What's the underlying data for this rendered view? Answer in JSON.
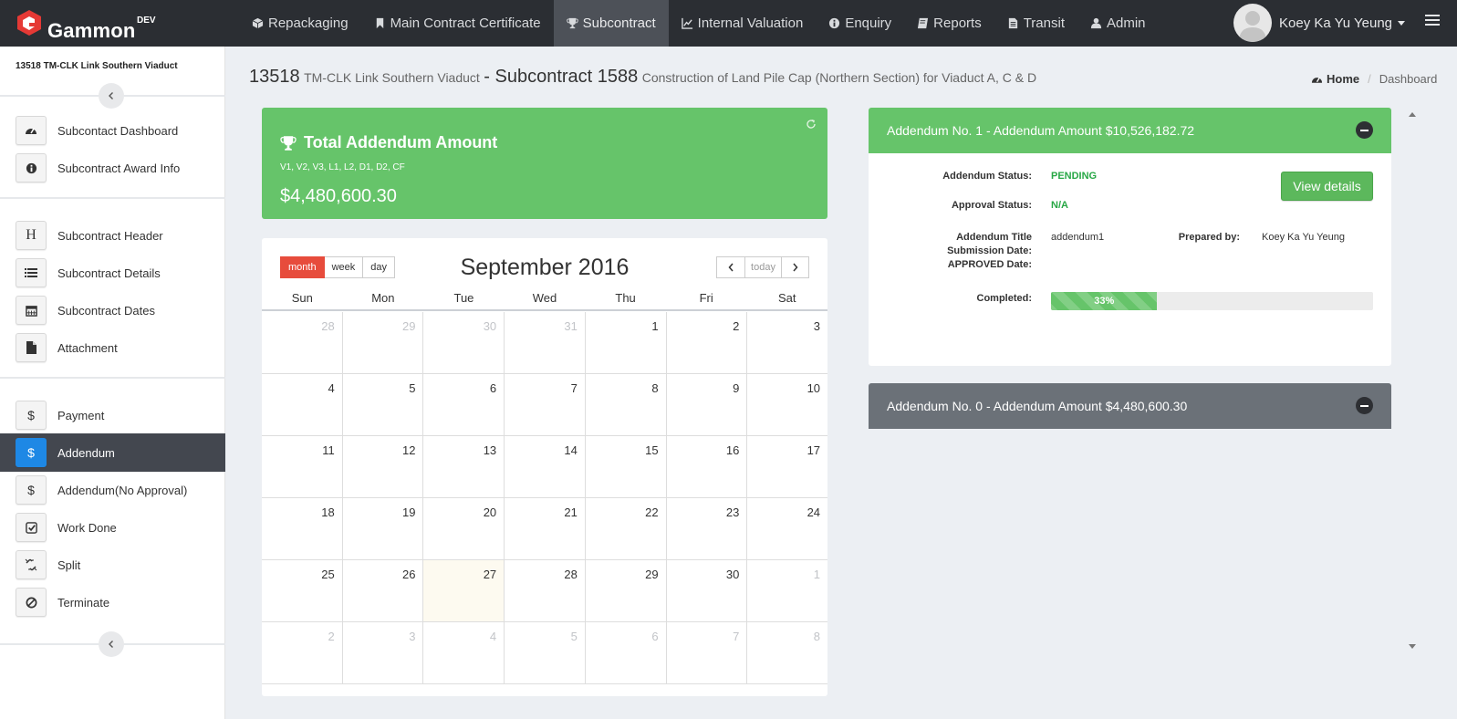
{
  "brand": {
    "name": "Gammon",
    "env": "DEV",
    "accent": "#e53935"
  },
  "nav": [
    {
      "label": "Repackaging",
      "icon": "cube-icon"
    },
    {
      "label": "Main Contract Certificate",
      "icon": "bookmark-icon"
    },
    {
      "label": "Subcontract",
      "icon": "trophy-icon",
      "active": true
    },
    {
      "label": "Internal Valuation",
      "icon": "line-chart-icon"
    },
    {
      "label": "Enquiry",
      "icon": "info-circle-icon"
    },
    {
      "label": "Reports",
      "icon": "book-icon"
    },
    {
      "label": "Transit",
      "icon": "file-icon"
    },
    {
      "label": "Admin",
      "icon": "user-icon"
    }
  ],
  "user": {
    "name": "Koey Ka Yu Yeung"
  },
  "sidebar": {
    "project": "13518 TM-CLK Link Southern Viaduct",
    "items": [
      {
        "label": "Subcontact Dashboard",
        "icon": "dashboard-icon"
      },
      {
        "label": "Subcontract Award Info",
        "icon": "info-circle-icon"
      },
      {
        "label": "Subcontract Header",
        "icon": "header-icon",
        "glyph": "H"
      },
      {
        "label": "Subcontract Details",
        "icon": "list-icon"
      },
      {
        "label": "Subcontract Dates",
        "icon": "calendar-icon"
      },
      {
        "label": "Attachment",
        "icon": "file-icon"
      },
      {
        "label": "Payment",
        "icon": "dollar-icon",
        "glyph": "$"
      },
      {
        "label": "Addendum",
        "icon": "dollar-icon",
        "glyph": "$",
        "active": true
      },
      {
        "label": "Addendum(No Approval)",
        "icon": "dollar-icon",
        "glyph": "$"
      },
      {
        "label": "Work Done",
        "icon": "check-square-icon"
      },
      {
        "label": "Split",
        "icon": "unlink-icon"
      },
      {
        "label": "Terminate",
        "icon": "ban-icon"
      }
    ]
  },
  "header": {
    "job_no": "13518",
    "job_name": "TM-CLK Link Southern Viaduct",
    "subcontract_label": "- Subcontract 1588",
    "subcontract_desc": "Construction of Land Pile Cap (Northern Section) for Viaduct A, C & D"
  },
  "breadcrumb": {
    "home": "Home",
    "current": "Dashboard"
  },
  "total_card": {
    "title": "Total Addendum Amount",
    "codes": "V1, V2, V3, L1, L2, D1, D2, CF",
    "amount": "$4,480,600.30"
  },
  "calendar": {
    "views": [
      "month",
      "week",
      "day"
    ],
    "active_view": "month",
    "title": "September 2016",
    "today_label": "today",
    "weekdays": [
      "Sun",
      "Mon",
      "Tue",
      "Wed",
      "Thu",
      "Fri",
      "Sat"
    ],
    "weeks": [
      [
        {
          "d": "28",
          "o": 1
        },
        {
          "d": "29",
          "o": 1
        },
        {
          "d": "30",
          "o": 1
        },
        {
          "d": "31",
          "o": 1
        },
        {
          "d": "1"
        },
        {
          "d": "2"
        },
        {
          "d": "3"
        }
      ],
      [
        {
          "d": "4"
        },
        {
          "d": "5"
        },
        {
          "d": "6"
        },
        {
          "d": "7"
        },
        {
          "d": "8"
        },
        {
          "d": "9"
        },
        {
          "d": "10"
        }
      ],
      [
        {
          "d": "11"
        },
        {
          "d": "12"
        },
        {
          "d": "13"
        },
        {
          "d": "14"
        },
        {
          "d": "15"
        },
        {
          "d": "16"
        },
        {
          "d": "17"
        }
      ],
      [
        {
          "d": "18"
        },
        {
          "d": "19"
        },
        {
          "d": "20"
        },
        {
          "d": "21"
        },
        {
          "d": "22"
        },
        {
          "d": "23"
        },
        {
          "d": "24"
        }
      ],
      [
        {
          "d": "25"
        },
        {
          "d": "26"
        },
        {
          "d": "27",
          "t": 1
        },
        {
          "d": "28"
        },
        {
          "d": "29"
        },
        {
          "d": "30"
        },
        {
          "d": "1",
          "o": 1
        }
      ],
      [
        {
          "d": "2",
          "o": 1
        },
        {
          "d": "3",
          "o": 1
        },
        {
          "d": "4",
          "o": 1
        },
        {
          "d": "5",
          "o": 1
        },
        {
          "d": "6",
          "o": 1
        },
        {
          "d": "7",
          "o": 1
        },
        {
          "d": "8",
          "o": 1
        }
      ]
    ]
  },
  "addendum1": {
    "header": "Addendum No. 1 - Addendum Amount $10,526,182.72",
    "status_label": "Addendum Status:",
    "status": "PENDING",
    "approval_label": "Approval Status:",
    "approval": "N/A",
    "title_label": "Addendum Title",
    "title_value": "addendum1",
    "submission_label": "Submission Date:",
    "approved_label": "APPROVED Date:",
    "prepared_label": "Prepared by:",
    "prepared_value": "Koey Ka Yu Yeung",
    "completed_label": "Completed:",
    "completed_text": "33%",
    "completed_fraction": 0.33,
    "view_button": "View details"
  },
  "addendum0": {
    "header": "Addendum No. 0 - Addendum Amount $4,480,600.30"
  }
}
